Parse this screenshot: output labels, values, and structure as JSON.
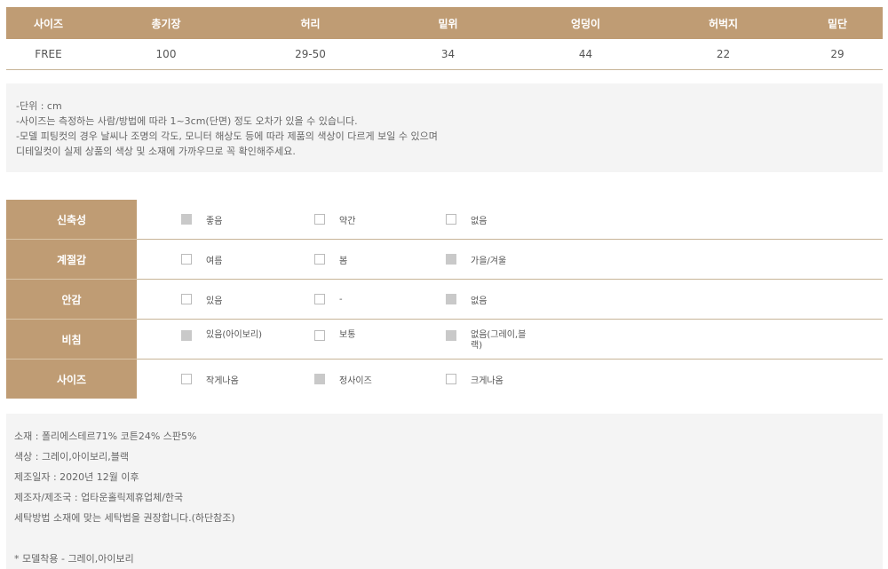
{
  "size_table": {
    "headers": [
      "사이즈",
      "총기장",
      "허리",
      "밑위",
      "엉덩이",
      "허벅지",
      "밑단"
    ],
    "rows": [
      [
        "FREE",
        "100",
        "29-50",
        "34",
        "44",
        "22",
        "29"
      ]
    ]
  },
  "notes": [
    "-단위 : cm",
    "-사이즈는 측정하는 사람/방법에 따라 1~3cm(단면) 정도 오차가 있을 수 있습니다.",
    "-모델 피팅컷의 경우 날씨나 조명의 각도, 모니터 해상도 등에 따라 제품의 색상이 다르게 보일 수 있으며",
    "디테일컷이 실제 상품의 색상 및 소재에 가까우므로 꼭 확인해주세요."
  ],
  "properties": [
    {
      "label": "신축성",
      "options": [
        {
          "text": "좋음",
          "checked": true
        },
        {
          "text": "약간",
          "checked": false
        },
        {
          "text": "없음",
          "checked": false
        }
      ]
    },
    {
      "label": "계절감",
      "options": [
        {
          "text": "여름",
          "checked": false
        },
        {
          "text": "봄",
          "checked": false
        },
        {
          "text": "가을/겨울",
          "checked": true
        }
      ]
    },
    {
      "label": "안감",
      "options": [
        {
          "text": "있음",
          "checked": false
        },
        {
          "text": "-",
          "checked": false
        },
        {
          "text": "없음",
          "checked": true
        }
      ]
    },
    {
      "label": "비침",
      "options": [
        {
          "text": "있음(아이보리)",
          "checked": true
        },
        {
          "text": "보통",
          "checked": false
        },
        {
          "text": "없음(그레이,블랙)",
          "checked": true
        }
      ]
    },
    {
      "label": "사이즈",
      "options": [
        {
          "text": "작게나옴",
          "checked": false
        },
        {
          "text": "정사이즈",
          "checked": true
        },
        {
          "text": "크게나옴",
          "checked": false
        }
      ]
    }
  ],
  "info": {
    "lines": [
      "소재 : 폴리에스테르71% 코튼24% 스판5%",
      "색상 : 그레이,아이보리,블랙",
      "제조일자 : 2020년 12월 이후",
      "제조자/제조국 : 업타운홀릭제휴업체/한국",
      "세탁방법 소재에 맞는 세탁법을 권장합니다.(하단참조)"
    ],
    "footnote": "* 모델착용 - 그레이,아이보리"
  },
  "colors": {
    "header_bg": "#bf9c74",
    "note_bg": "#f4f4f4",
    "checked_box": "#c9c9c9"
  }
}
